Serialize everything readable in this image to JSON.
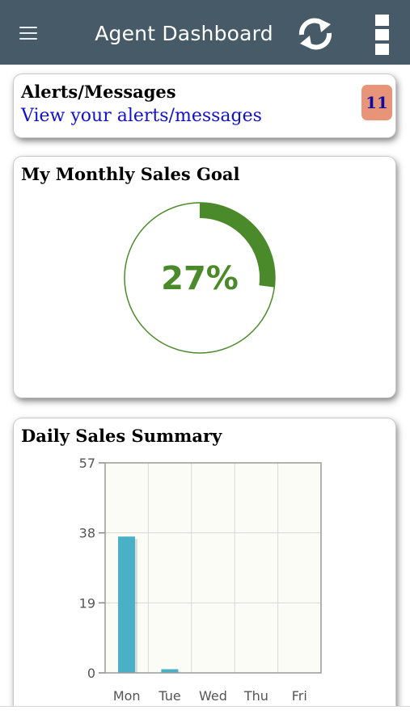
{
  "header": {
    "title": "Agent Dashboard",
    "background_color": "#465a68",
    "icons": {
      "menu": "hamburger-menu-icon",
      "refresh": "refresh-icon",
      "more": "more-vertical-icon"
    }
  },
  "alerts": {
    "title": "Alerts/Messages",
    "link_text": "View your alerts/messages",
    "count": "11",
    "badge_color": "#e89479"
  },
  "monthly_goal": {
    "title": "My Monthly Sales Goal",
    "percent_label": "27%",
    "progress": 0.27,
    "color": "#4a8a2a"
  },
  "daily_sales": {
    "title": "Daily Sales Summary"
  },
  "chart_data": {
    "type": "bar",
    "title": "Daily Sales Summary",
    "categories": [
      "Mon",
      "Tue",
      "Wed",
      "Thu",
      "Fri"
    ],
    "values": [
      37,
      1,
      0,
      0,
      0
    ],
    "ylim": [
      0,
      57
    ],
    "yticks": [
      "0",
      "19",
      "38",
      "57"
    ],
    "grid": true,
    "bar_color": "#4ab0c6",
    "plot_background": "#fcfcf6"
  }
}
